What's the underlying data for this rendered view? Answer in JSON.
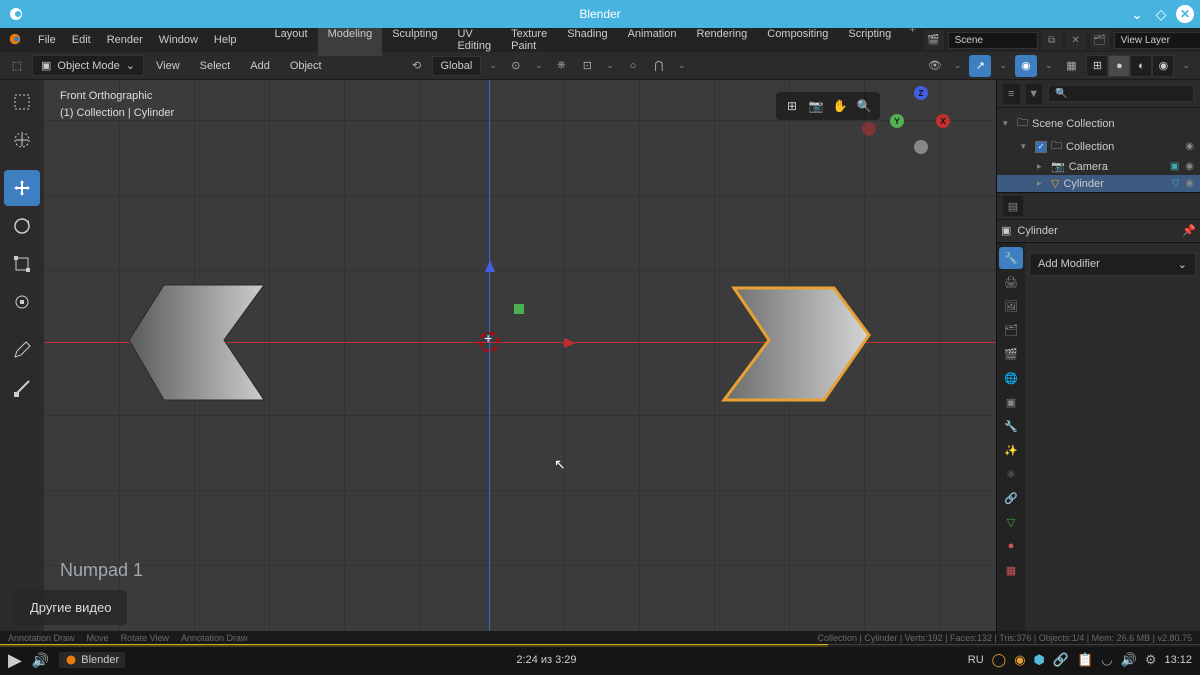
{
  "titlebar": {
    "title": "Blender"
  },
  "menubar": {
    "items": [
      "File",
      "Edit",
      "Render",
      "Window",
      "Help"
    ],
    "workspaces": [
      "Layout",
      "Modeling",
      "Sculpting",
      "UV Editing",
      "Texture Paint",
      "Shading",
      "Animation",
      "Rendering",
      "Compositing",
      "Scripting"
    ],
    "active_workspace": "Modeling",
    "scene_label": "Scene",
    "layer_label": "View Layer"
  },
  "header": {
    "mode": "Object Mode",
    "view": "View",
    "select": "Select",
    "add": "Add",
    "object": "Object",
    "orientation": "Global"
  },
  "viewport": {
    "view_name": "Front Orthographic",
    "collection_path": "(1) Collection | Cylinder",
    "key_hint": "Numpad 1"
  },
  "outliner": {
    "root": "Scene Collection",
    "collection": "Collection",
    "items": [
      {
        "name": "Camera",
        "icon": "camera-icon"
      },
      {
        "name": "Cylinder",
        "icon": "mesh-icon",
        "selected": true
      }
    ]
  },
  "properties": {
    "object_name": "Cylinder",
    "add_modifier": "Add Modifier"
  },
  "statusbar": {
    "left1": "Annotation Draw",
    "left2": "Move",
    "left3": "Rotate View",
    "left4": "Annotation Draw",
    "right": "Collection | Cylinder | Verts:192 | Faces:132 | Tris:376 | Objects:1/4 | Mem: 26.6 MB | v2.80.75"
  },
  "video": {
    "other_videos": "Другие видео",
    "time": "2:24 из 3:29",
    "taskbar_app": "Blender",
    "lang": "RU",
    "clock": "13:12"
  }
}
